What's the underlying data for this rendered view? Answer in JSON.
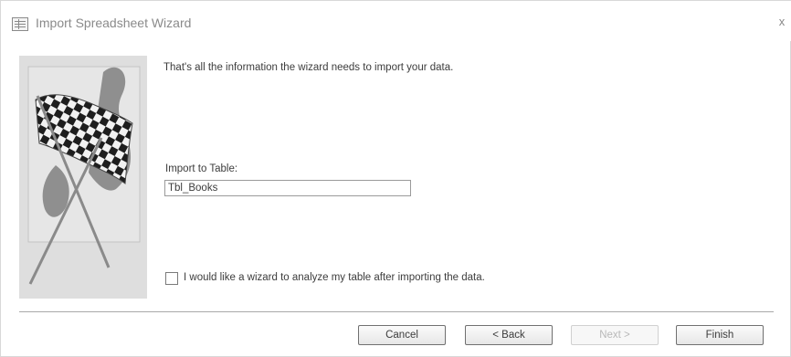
{
  "window": {
    "title": "Import Spreadsheet Wizard",
    "close_glyph": "x"
  },
  "icons": {
    "title_icon": "spreadsheet-icon",
    "side_art": "checkered-flag-icon",
    "close": "close-icon"
  },
  "content": {
    "message": "That's all the information the wizard needs to import your data.",
    "import_label": "Import to Table:",
    "table_name": "Tbl_Books",
    "analyze_checkbox_label": "I would like a wizard to analyze my table after importing the data.",
    "analyze_checked": false
  },
  "buttons": {
    "cancel": "Cancel",
    "back": "< Back",
    "next": "Next >",
    "finish": "Finish"
  },
  "colors": {
    "background": "#ffffff",
    "side_panel": "#dedede",
    "disabled_text": "#b8b8b8"
  }
}
